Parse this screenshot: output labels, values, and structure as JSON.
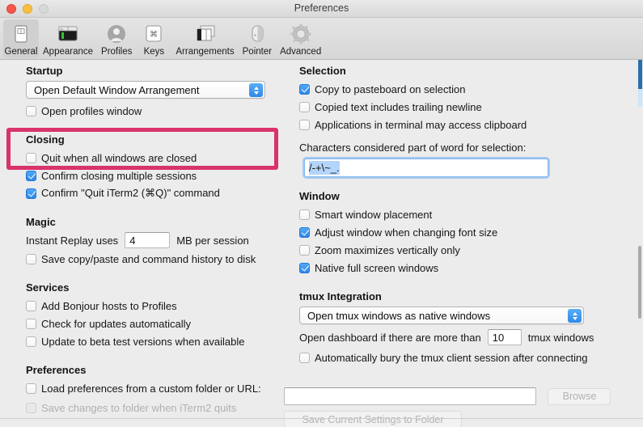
{
  "window": {
    "title": "Preferences",
    "traffic_lights": [
      "close-button",
      "minimize-button",
      "zoom-button"
    ]
  },
  "toolbar": {
    "items": [
      {
        "label": "General",
        "icon": "general-icon",
        "selected": true
      },
      {
        "label": "Appearance",
        "icon": "appearance-icon",
        "selected": false
      },
      {
        "label": "Profiles",
        "icon": "profiles-icon",
        "selected": false
      },
      {
        "label": "Keys",
        "icon": "keys-icon",
        "selected": false
      },
      {
        "label": "Arrangements",
        "icon": "arrangements-icon",
        "selected": false
      },
      {
        "label": "Pointer",
        "icon": "pointer-icon",
        "selected": false
      },
      {
        "label": "Advanced",
        "icon": "advanced-icon",
        "selected": false
      }
    ]
  },
  "highlight": {
    "color": "#d8336b",
    "target": "startup-section"
  },
  "left": {
    "startup": {
      "title": "Startup",
      "select_value": "Open Default Window Arrangement",
      "open_profiles_window": {
        "label": "Open profiles window",
        "checked": false
      }
    },
    "closing": {
      "title": "Closing",
      "items": [
        {
          "label": "Quit when all windows are closed",
          "checked": false
        },
        {
          "label": "Confirm closing multiple sessions",
          "checked": true
        },
        {
          "label": "Confirm \"Quit iTerm2 (⌘Q)\" command",
          "checked": true
        }
      ]
    },
    "magic": {
      "title": "Magic",
      "replay_prefix": "Instant Replay uses",
      "replay_value": "4",
      "replay_suffix": "MB per session",
      "save_history": {
        "label": "Save copy/paste and command history to disk",
        "checked": false
      }
    },
    "services": {
      "title": "Services",
      "items": [
        {
          "label": "Add Bonjour hosts to Profiles",
          "checked": false
        },
        {
          "label": "Check for updates automatically",
          "checked": false
        },
        {
          "label": "Update to beta test versions when available",
          "checked": false
        }
      ]
    },
    "preferences": {
      "title": "Preferences",
      "load_prefs": {
        "label": "Load preferences from a custom folder or URL:",
        "checked": false
      },
      "save_changes": {
        "label": "Save changes to folder when iTerm2 quits",
        "checked": false,
        "disabled": true
      }
    }
  },
  "right": {
    "selection": {
      "title": "Selection",
      "items": [
        {
          "label": "Copy to pasteboard on selection",
          "checked": true
        },
        {
          "label": "Copied text includes trailing newline",
          "checked": false
        },
        {
          "label": "Applications in terminal may access clipboard",
          "checked": false
        }
      ],
      "word_chars_label": "Characters considered part of word for selection:",
      "word_chars_value": "/-+\\~_."
    },
    "window": {
      "title": "Window",
      "items": [
        {
          "label": "Smart window placement",
          "checked": false
        },
        {
          "label": "Adjust window when changing font size",
          "checked": true
        },
        {
          "label": "Zoom maximizes vertically only",
          "checked": false
        },
        {
          "label": "Native full screen windows",
          "checked": true
        }
      ]
    },
    "tmux": {
      "title": "tmux Integration",
      "select_value": "Open tmux windows as native windows",
      "dashboard_prefix": "Open dashboard if there are more than",
      "dashboard_value": "10",
      "dashboard_suffix": "tmux windows",
      "bury": {
        "label": "Automatically bury the tmux client session after connecting",
        "checked": false
      }
    }
  },
  "bottom": {
    "path_value": "",
    "path_placeholder": "",
    "browse_label": "Browse",
    "save_settings_label": "Save Current Settings to Folder"
  }
}
